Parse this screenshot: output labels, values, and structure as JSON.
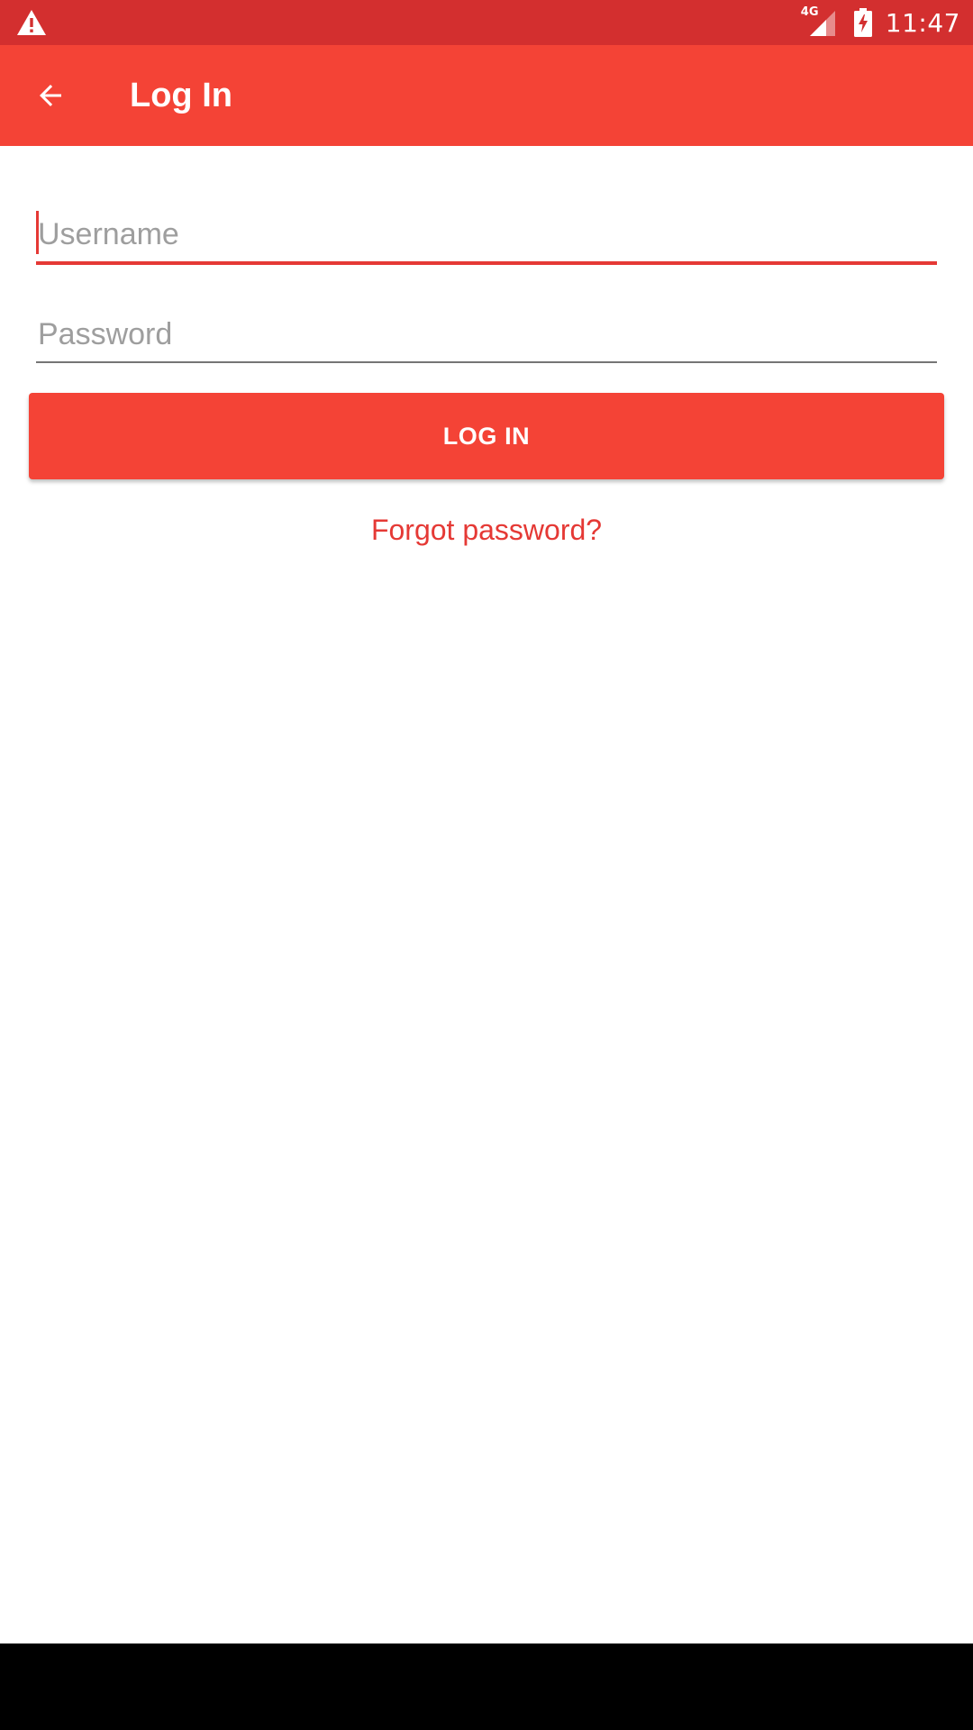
{
  "status_bar": {
    "time": "11:47",
    "network_type": "4G",
    "icons": [
      "warning-icon",
      "signal-icon",
      "battery-charging-icon"
    ]
  },
  "app_bar": {
    "title": "Log In",
    "back_icon": "arrow-back-icon"
  },
  "form": {
    "username": {
      "placeholder": "Username",
      "value": ""
    },
    "password": {
      "placeholder": "Password",
      "value": ""
    },
    "login_label": "LOG IN",
    "forgot_label": "Forgot password?"
  },
  "colors": {
    "status_bar": "#d32f2f",
    "primary": "#f44336",
    "accent": "#e53935",
    "placeholder": "#9e9e9e"
  }
}
